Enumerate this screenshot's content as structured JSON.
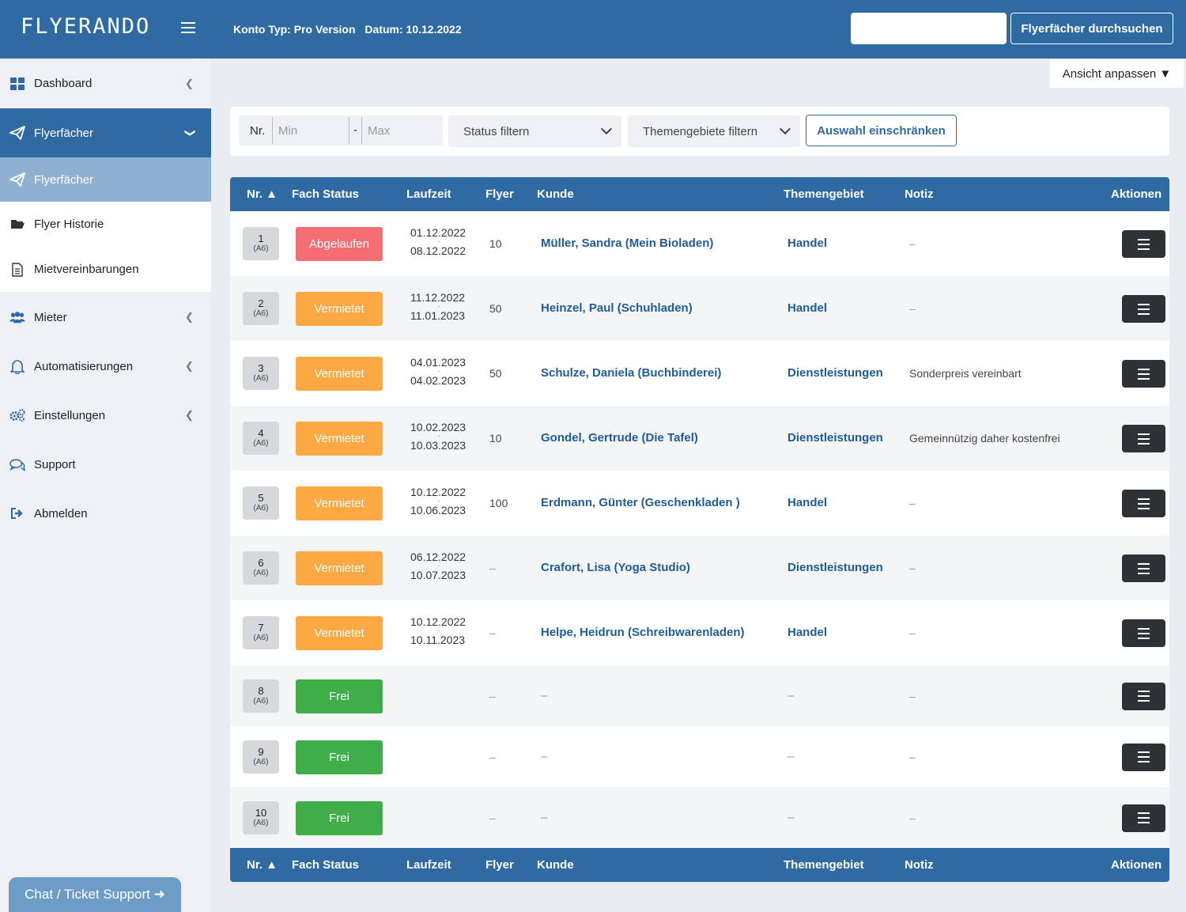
{
  "header": {
    "logo": "FLYERANDO",
    "account_type": "Konto Typ: Pro Version",
    "date": "Datum: 10.12.2022",
    "search_value": "",
    "search_button": "Flyerfächer durchsuchen"
  },
  "sidebar": {
    "items": [
      {
        "label": "Dashboard",
        "icon": "dashboard-grid-icon"
      },
      {
        "label": "Flyerfächer",
        "icon": "paper-plane-icon"
      },
      {
        "label": "Flyerfächer",
        "icon": "paper-plane-icon"
      },
      {
        "label": "Flyer Historie",
        "icon": "folder-open-icon"
      },
      {
        "label": "Mietvereinbarungen",
        "icon": "document-icon"
      },
      {
        "label": "Mieter",
        "icon": "users-icon"
      },
      {
        "label": "Automatisierungen",
        "icon": "bell-icon"
      },
      {
        "label": "Einstellungen",
        "icon": "gears-icon"
      },
      {
        "label": "Support",
        "icon": "chat-bubbles-icon"
      },
      {
        "label": "Abmelden",
        "icon": "sign-out-icon"
      }
    ],
    "chat_button": "Chat / Ticket Support ➜"
  },
  "view_button": "Ansicht anpassen ▼",
  "filters": {
    "nr_label": "Nr.",
    "min_placeholder": "Min",
    "dash": "-",
    "max_placeholder": "Max",
    "status_select": "Status filtern",
    "topic_select": "Themengebiete filtern",
    "restrict_button": "Auswahl einschränken"
  },
  "table": {
    "columns": [
      "Nr. ▲",
      "Fach Status",
      "Laufzeit",
      "Flyer",
      "Kunde",
      "Themengebiet",
      "Notiz",
      "Aktionen"
    ],
    "rows": [
      {
        "nr": "1",
        "size": "(A6)",
        "status": "Abgelaufen",
        "status_color": "#f36d72",
        "start": "01.12.2022",
        "sep": "-",
        "end": "08.12.2022",
        "flyer": "10",
        "kunde": "Müller, Sandra (Mein Bioladen)",
        "thema": "Handel",
        "notiz": "–"
      },
      {
        "nr": "2",
        "size": "(A6)",
        "status": "Vermietet",
        "status_color": "#fca944",
        "start": "11.12.2022",
        "sep": "-",
        "end": "11.01.2023",
        "flyer": "50",
        "kunde": "Heinzel, Paul (Schuhladen)",
        "thema": "Handel",
        "notiz": "–"
      },
      {
        "nr": "3",
        "size": "(A6)",
        "status": "Vermietet",
        "status_color": "#fca944",
        "start": "04.01.2023",
        "sep": "-",
        "end": "04.02.2023",
        "flyer": "50",
        "kunde": "Schulze, Daniela (Buchbinderei)",
        "thema": "Dienstleistungen",
        "notiz": "Sonderpreis vereinbart"
      },
      {
        "nr": "4",
        "size": "(A6)",
        "status": "Vermietet",
        "status_color": "#fca944",
        "start": "10.02.2023",
        "sep": "-",
        "end": "10.03.2023",
        "flyer": "10",
        "kunde": "Gondel, Gertrude (Die Tafel)",
        "thema": "Dienstleistungen",
        "notiz": "Gemeinnützig daher kostenfrei"
      },
      {
        "nr": "5",
        "size": "(A6)",
        "status": "Vermietet",
        "status_color": "#fca944",
        "start": "10.12.2022",
        "sep": "-",
        "end": "10.06.2023",
        "flyer": "100",
        "kunde": "Erdmann, Günter (Geschenkladen )",
        "thema": "Handel",
        "notiz": "–"
      },
      {
        "nr": "6",
        "size": "(A6)",
        "status": "Vermietet",
        "status_color": "#fca944",
        "start": "06.12.2022",
        "sep": "-",
        "end": "10.07.2023",
        "flyer": "–",
        "kunde": "Crafort, Lisa (Yoga Studio)",
        "thema": "Dienstleistungen",
        "notiz": "–"
      },
      {
        "nr": "7",
        "size": "(A6)",
        "status": "Vermietet",
        "status_color": "#fca944",
        "start": "10.12.2022",
        "sep": "-",
        "end": "10.11.2023",
        "flyer": "–",
        "kunde": "Helpe, Heidrun (Schreibwarenladen)",
        "thema": "Handel",
        "notiz": "–"
      },
      {
        "nr": "8",
        "size": "(A6)",
        "status": "Frei",
        "status_color": "#3fae48",
        "start": "",
        "sep": "",
        "end": "",
        "flyer": "–",
        "kunde": "–",
        "thema": "–",
        "notiz": "–"
      },
      {
        "nr": "9",
        "size": "(A6)",
        "status": "Frei",
        "status_color": "#3fae48",
        "start": "",
        "sep": "",
        "end": "",
        "flyer": "–",
        "kunde": "–",
        "thema": "–",
        "notiz": "–"
      },
      {
        "nr": "10",
        "size": "(A6)",
        "status": "Frei",
        "status_color": "#3fae48",
        "start": "",
        "sep": "",
        "end": "",
        "flyer": "–",
        "kunde": "–",
        "thema": "–",
        "notiz": "–"
      }
    ]
  },
  "colors": {
    "primary": "#2f6aa3",
    "expired": "#f36d72",
    "rented": "#fca944",
    "free": "#3fae48"
  }
}
